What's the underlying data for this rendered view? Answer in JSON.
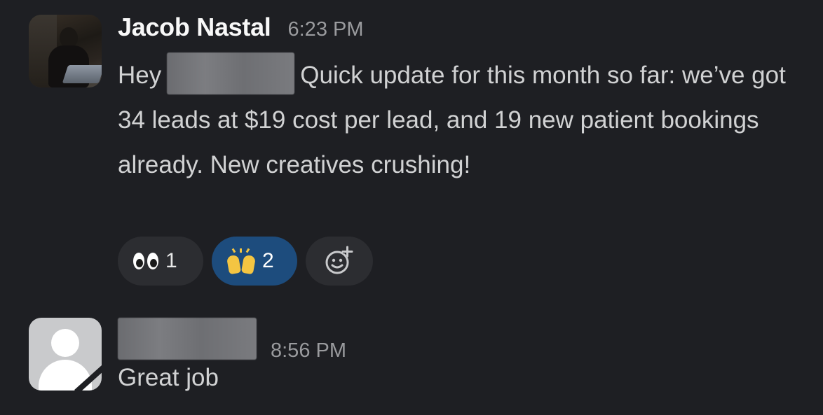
{
  "messages": [
    {
      "author": "Jacob Nastal",
      "time": "6:23 PM",
      "greeting": "Hey",
      "text_after_redaction": "Quick update for this month so far: we’ve got 34 leads at $19 cost per lead, and 19 new patient bookings already. New creatives crushing!",
      "reactions": [
        {
          "emoji": "eyes-emoji",
          "count": "1",
          "active": false
        },
        {
          "emoji": "raised-hands-emoji",
          "count": "2",
          "active": true
        }
      ]
    },
    {
      "author": "",
      "time": "8:56 PM",
      "text": "Great job"
    }
  ],
  "colors": {
    "background": "#1e1f23",
    "reaction_bg": "#2c2d31",
    "reaction_active_bg": "#1d4c7d",
    "author": "#f8f8f8",
    "body_text": "#d1d2d3",
    "timestamp": "#9a9b9e"
  }
}
